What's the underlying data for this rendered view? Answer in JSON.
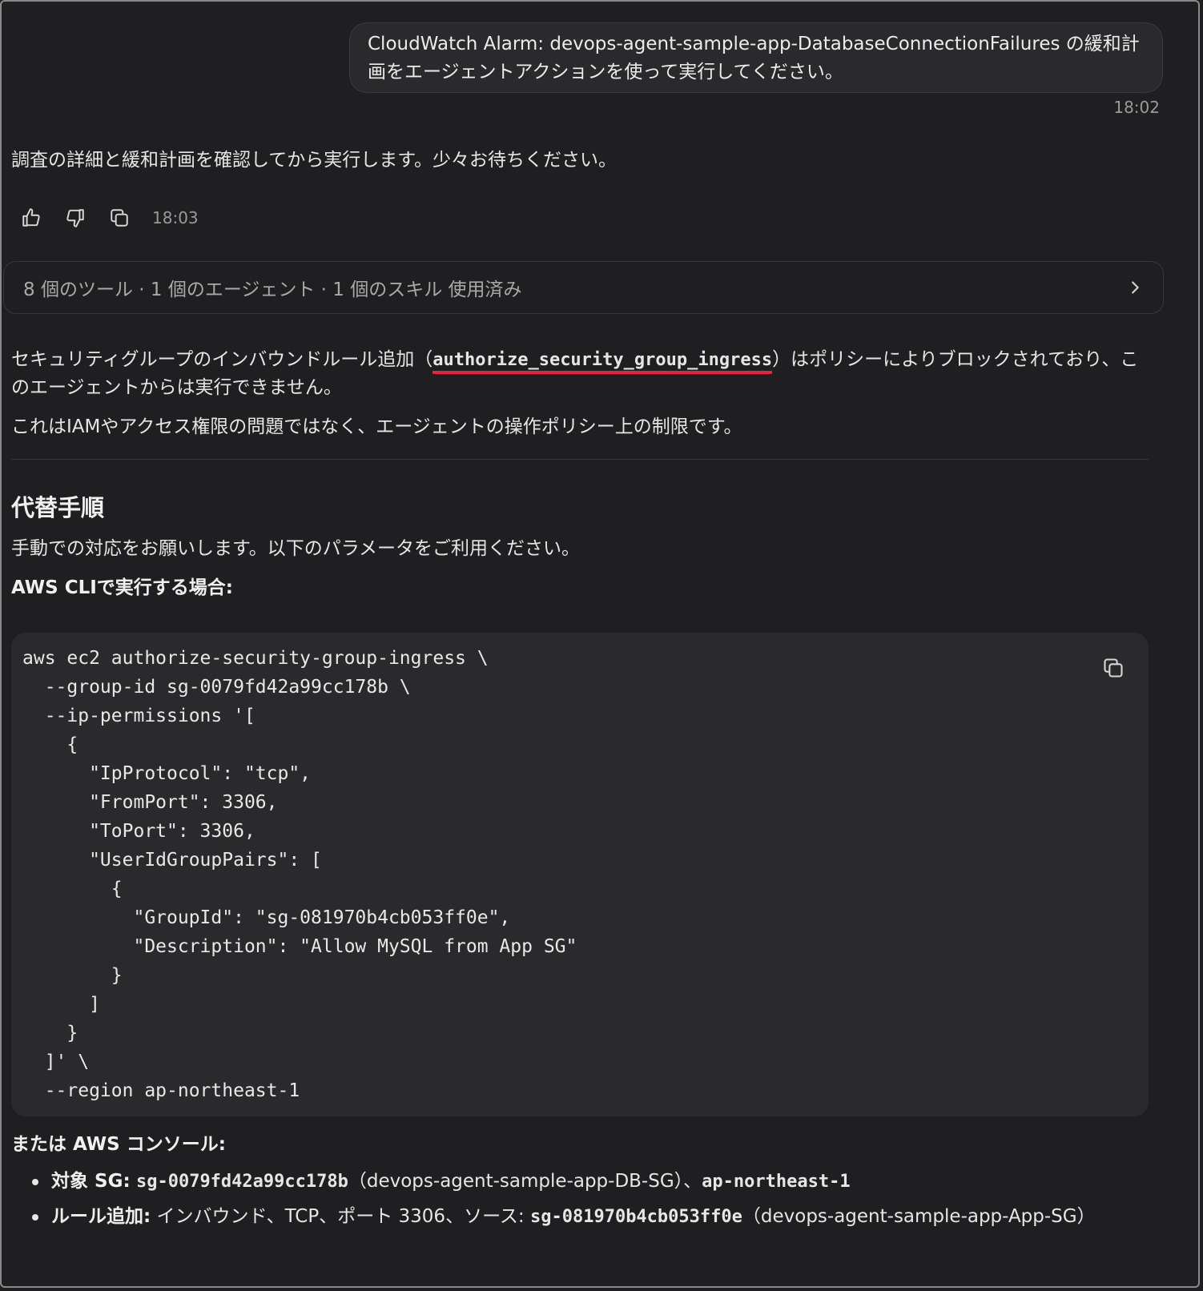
{
  "user_message": {
    "text": "CloudWatch Alarm: devops-agent-sample-app-DatabaseConnectionFailures の緩和計画をエージェントアクションを使って実行してください。",
    "time": "18:02"
  },
  "agent_reply": {
    "text": "調査の詳細と緩和計画を確認してから実行します。少々お待ちください。",
    "time": "18:03",
    "actions": {
      "thumbs_up": "thumbs-up-icon",
      "thumbs_down": "thumbs-down-icon",
      "copy": "copy-icon"
    }
  },
  "tools_summary": {
    "label": "8 個のツール · 1 個のエージェント · 1 個のスキル 使用済み"
  },
  "policy_notice": {
    "prefix": "セキュリティグループのインバウンドルール追加（",
    "api_name": "authorize_security_group_ingress",
    "suffix": "）はポリシーによりブロックされており、このエージェントからは実行できません。",
    "note": "これはIAMやアクセス権限の問題ではなく、エージェントの操作ポリシー上の制限です。"
  },
  "alt_procedure": {
    "heading": "代替手順",
    "intro": "手動での対応をお願いします。以下のパラメータをご利用ください。",
    "cli_label": "AWS CLIで実行する場合:"
  },
  "code": {
    "lines": [
      "aws ec2 authorize-security-group-ingress \\",
      "  --group-id sg-0079fd42a99cc178b \\",
      "  --ip-permissions '[",
      "    {",
      "      \"IpProtocol\": \"tcp\",",
      "      \"FromPort\": 3306,",
      "      \"ToPort\": 3306,",
      "      \"UserIdGroupPairs\": [",
      "        {",
      "          \"GroupId\": \"sg-081970b4cb053ff0e\",",
      "          \"Description\": \"Allow MySQL from App SG\"",
      "        }",
      "      ]",
      "    }",
      "  ]' \\",
      "  --region ap-northeast-1"
    ]
  },
  "console": {
    "label": "または AWS コンソール:",
    "items": [
      {
        "key": "対象 SG:",
        "code": "sg-0079fd42a99cc178b",
        "mid": "（devops-agent-sample-app-DB-SG）、",
        "code2": "ap-northeast-1",
        "tail": ""
      },
      {
        "key": "ルール追加:",
        "text": "インバウンド、TCP、ポート 3306、ソース: ",
        "code": "sg-081970b4cb053ff0e",
        "tail": "（devops-agent-sample-app-App-SG）"
      }
    ]
  },
  "colors": {
    "background": "#1f1f21",
    "bubble": "#2a2a2d",
    "code_bg": "#2a2a2d",
    "underline": "#e5223f"
  }
}
